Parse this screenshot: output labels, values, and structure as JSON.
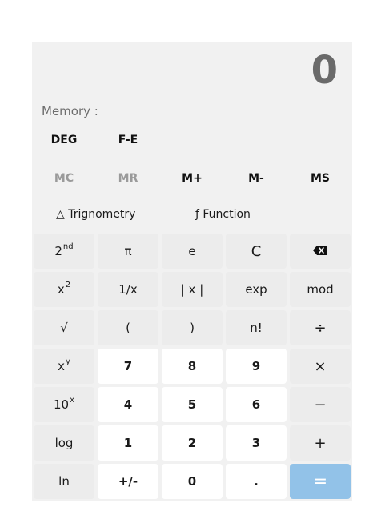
{
  "display": {
    "value": "0"
  },
  "memory_label": "Memory :",
  "modes": {
    "angle": "DEG",
    "format": "F-E"
  },
  "memory_buttons": [
    {
      "label": "MC",
      "enabled": false
    },
    {
      "label": "MR",
      "enabled": false
    },
    {
      "label": "M+",
      "enabled": true
    },
    {
      "label": "M-",
      "enabled": true
    },
    {
      "label": "MS",
      "enabled": true
    }
  ],
  "menus": {
    "trig": "△ Trignometry",
    "func": "ƒ Function"
  },
  "keys": {
    "second": {
      "base": "2",
      "sup": "nd"
    },
    "pi": "π",
    "e": "e",
    "clear": "C",
    "backspace": "⌫",
    "square": {
      "base": "x",
      "sup": "2"
    },
    "reciprocal": "1/x",
    "abs": "| x |",
    "exp": "exp",
    "mod": "mod",
    "sqrt": "√",
    "lparen": "(",
    "rparen": ")",
    "factorial": "n!",
    "divide": "÷",
    "power": {
      "base": "x",
      "sup": "y"
    },
    "seven": "7",
    "eight": "8",
    "nine": "9",
    "multiply": "×",
    "tenpow": {
      "base": "10",
      "sup": "x"
    },
    "four": "4",
    "five": "5",
    "six": "6",
    "minus": "−",
    "log": "log",
    "one": "1",
    "two": "2",
    "three": "3",
    "plus": "+",
    "ln": "ln",
    "negate": "+/-",
    "zero": "0",
    "decimal": ".",
    "equals": "="
  },
  "colors": {
    "equals_bg": "#92c2e8",
    "panel_bg": "#f1f1f1"
  }
}
